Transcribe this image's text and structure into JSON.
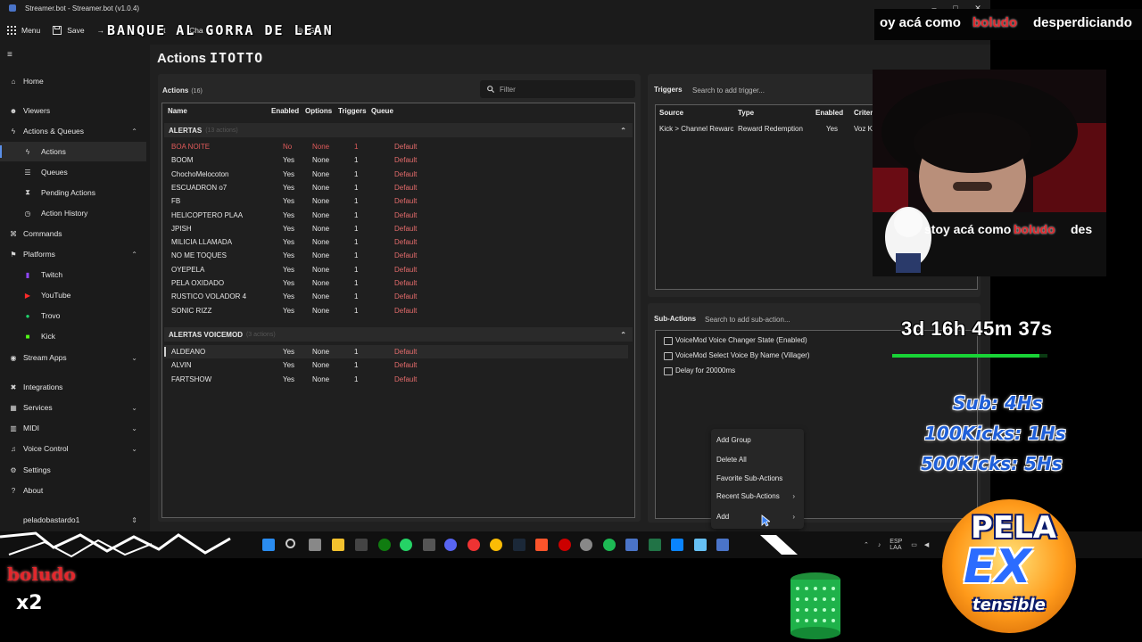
{
  "window": {
    "title": "Streamer.bot - Streamer.bot (v1.0.4)"
  },
  "toolbar": {
    "menu": "Menu",
    "save": "Save",
    "item3": "t",
    "item4": "Cha",
    "item5": "d",
    "item6": "Gl",
    "overlay_banner": "BANQUE AL GORRA DE LEAN"
  },
  "sidebar": {
    "items": [
      {
        "label": "Home",
        "icon": "home-icon"
      },
      {
        "label": "Viewers",
        "icon": "users-icon"
      },
      {
        "label": "Actions & Queues",
        "icon": "bolt-icon"
      },
      {
        "label": "Actions",
        "icon": "bolt-icon"
      },
      {
        "label": "Queues",
        "icon": "queue-icon"
      },
      {
        "label": "Pending Actions",
        "icon": "pending-icon"
      },
      {
        "label": "Action History",
        "icon": "history-icon"
      },
      {
        "label": "Commands",
        "icon": "command-icon"
      },
      {
        "label": "Platforms",
        "icon": "platform-icon"
      },
      {
        "label": "Twitch",
        "icon": "twitch-icon"
      },
      {
        "label": "YouTube",
        "icon": "youtube-icon"
      },
      {
        "label": "Trovo",
        "icon": "trovo-icon"
      },
      {
        "label": "Kick",
        "icon": "kick-icon"
      },
      {
        "label": "Stream Apps",
        "icon": "stream-apps-icon"
      },
      {
        "label": "Integrations",
        "icon": "integrations-icon"
      },
      {
        "label": "Services",
        "icon": "services-icon"
      },
      {
        "label": "MIDI",
        "icon": "midi-icon"
      },
      {
        "label": "Voice Control",
        "icon": "voice-icon"
      },
      {
        "label": "Settings",
        "icon": "gear-icon"
      },
      {
        "label": "About",
        "icon": "question-icon"
      }
    ],
    "user": "peladobastardo1"
  },
  "main": {
    "title": "Actions",
    "title_overlay": "ITOTTO",
    "actions": {
      "label": "Actions",
      "count": "(16)",
      "filter_placeholder": "Filter",
      "columns": [
        "Name",
        "Enabled",
        "Options",
        "Triggers",
        "Queue"
      ],
      "groups": [
        {
          "name": "ALERTAS",
          "count": "(13 actions)",
          "rows": [
            {
              "name": "BOA NOITE",
              "enabled": "No",
              "options": "None",
              "triggers": "1",
              "queue": "Default"
            },
            {
              "name": "BOOM",
              "enabled": "Yes",
              "options": "None",
              "triggers": "1",
              "queue": "Default"
            },
            {
              "name": "ChochoMelocoton",
              "enabled": "Yes",
              "options": "None",
              "triggers": "1",
              "queue": "Default"
            },
            {
              "name": "ESCUADRON o7",
              "enabled": "Yes",
              "options": "None",
              "triggers": "1",
              "queue": "Default"
            },
            {
              "name": "FB",
              "enabled": "Yes",
              "options": "None",
              "triggers": "1",
              "queue": "Default"
            },
            {
              "name": "HELICOPTERO PLAA",
              "enabled": "Yes",
              "options": "None",
              "triggers": "1",
              "queue": "Default"
            },
            {
              "name": "JPISH",
              "enabled": "Yes",
              "options": "None",
              "triggers": "1",
              "queue": "Default"
            },
            {
              "name": "MILICIA LLAMADA",
              "enabled": "Yes",
              "options": "None",
              "triggers": "1",
              "queue": "Default"
            },
            {
              "name": "NO ME TOQUES",
              "enabled": "Yes",
              "options": "None",
              "triggers": "1",
              "queue": "Default"
            },
            {
              "name": "OYEPELA",
              "enabled": "Yes",
              "options": "None",
              "triggers": "1",
              "queue": "Default"
            },
            {
              "name": "PELA OXIDADO",
              "enabled": "Yes",
              "options": "None",
              "triggers": "1",
              "queue": "Default"
            },
            {
              "name": "RUSTICO VOLADOR 4",
              "enabled": "Yes",
              "options": "None",
              "triggers": "1",
              "queue": "Default"
            },
            {
              "name": "SONIC RIZZ",
              "enabled": "Yes",
              "options": "None",
              "triggers": "1",
              "queue": "Default"
            }
          ]
        },
        {
          "name": "ALERTAS VOICEMOD",
          "count": "(3 actions)",
          "rows": [
            {
              "name": "ALDEANO",
              "enabled": "Yes",
              "options": "None",
              "triggers": "1",
              "queue": "Default"
            },
            {
              "name": "ALVIN",
              "enabled": "Yes",
              "options": "None",
              "triggers": "1",
              "queue": "Default"
            },
            {
              "name": "FARTSHOW",
              "enabled": "Yes",
              "options": "None",
              "triggers": "1",
              "queue": "Default"
            }
          ]
        }
      ]
    },
    "triggers": {
      "label": "Triggers",
      "search_placeholder": "Search to add trigger...",
      "columns": [
        "Source",
        "Type",
        "Enabled",
        "Criteria"
      ],
      "rows": [
        {
          "source": "Kick > Channel Rewarc",
          "type": "Reward Redemption",
          "enabled": "Yes",
          "criteria": "Voz Kawai Uwu"
        }
      ]
    },
    "sub_actions": {
      "label": "Sub-Actions",
      "search_placeholder": "Search to add sub-action...",
      "items": [
        "VoiceMod Voice Changer State (Enabled)",
        "VoiceMod Select Voice By Name (Villager)",
        "Delay for 20000ms"
      ],
      "context_menu": [
        "Add Group",
        "Delete All",
        "Favorite Sub-Actions",
        "Recent Sub-Actions",
        "Add"
      ]
    }
  },
  "overlay": {
    "chat_top": [
      "oy acá como",
      "boludo",
      "desperdiciando"
    ],
    "chat_mid": [
      "stoy acá como",
      "boludo",
      "des"
    ],
    "timer": "3d 16h 45m 37s",
    "timer_progress": 0.95,
    "goals": [
      "Sub: 4Hs",
      "100Kicks: 1Hs",
      "500Kicks: 5Hs"
    ],
    "badge_top": "PELA",
    "badge_mid": "EX",
    "badge_bottom": "tensible",
    "boludo_logo": "boludo",
    "boludo_multiplier": "x2",
    "systray_lang": "ESP",
    "systray_region": "LAA"
  },
  "colors": {
    "accent": "#5a8fe8",
    "disabled_row": "#e05a5a",
    "queue_text": "#e36b6b",
    "timer_bar": "#18d336",
    "goal_text": "#1f5fd8"
  }
}
